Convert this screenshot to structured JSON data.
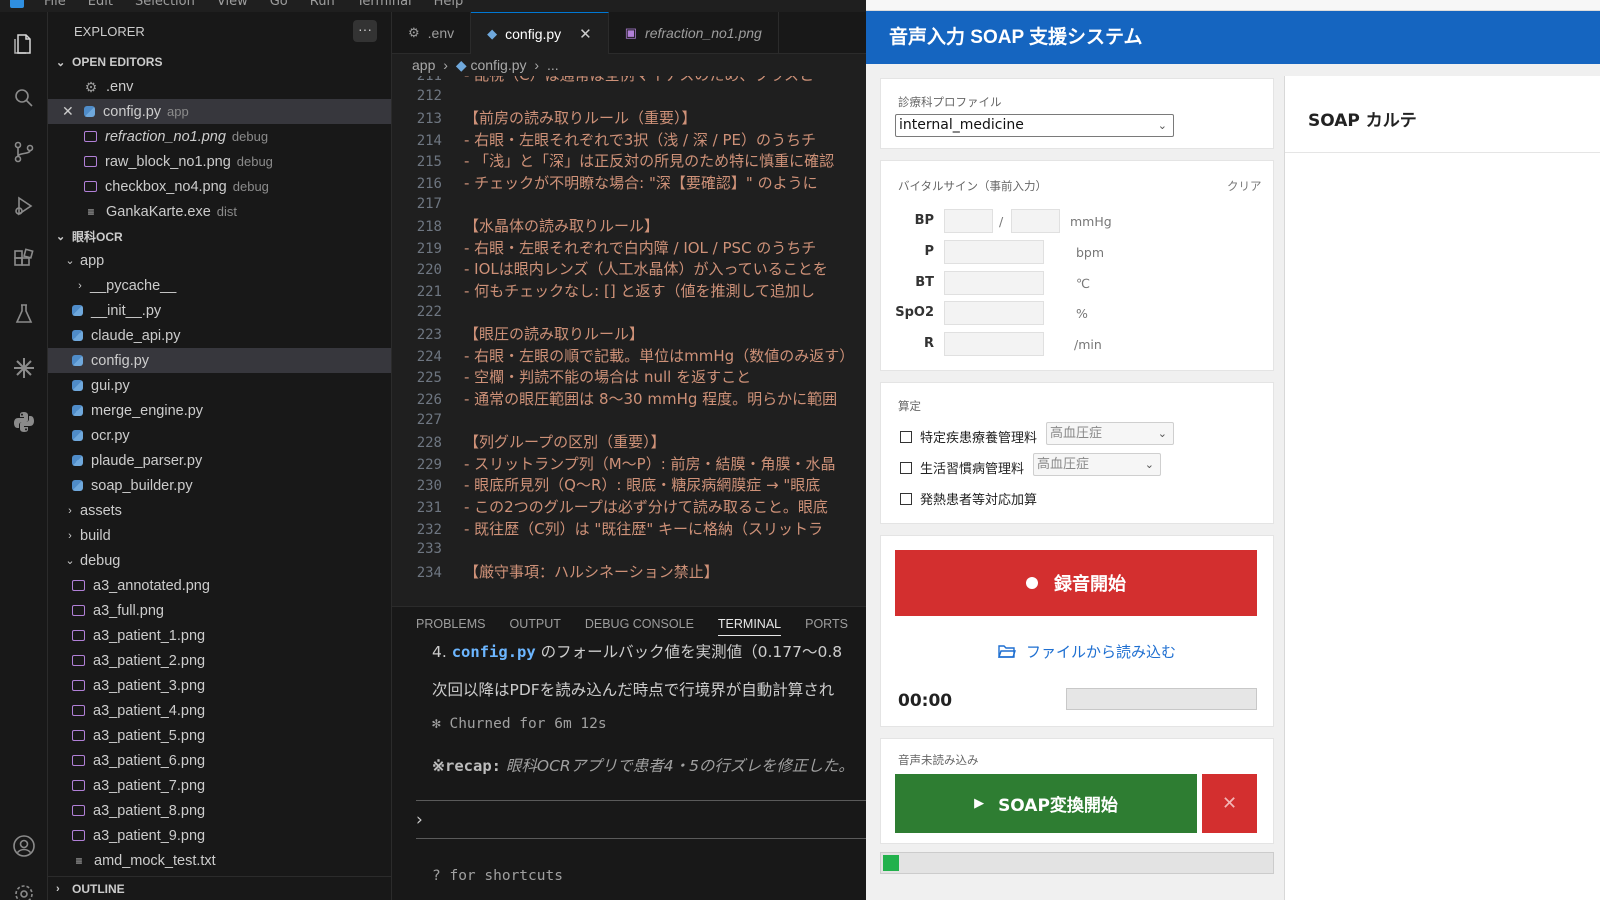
{
  "vscode": {
    "menu": [
      "File",
      "Edit",
      "Selection",
      "View",
      "Go",
      "Run",
      "Terminal",
      "Help"
    ],
    "explorer_title": "EXPLORER",
    "more": "···",
    "open_editors": {
      "label": "OPEN EDITORS",
      "items": [
        {
          "name": ".env",
          "hint": "",
          "type": "gear"
        },
        {
          "name": "config.py",
          "hint": "app",
          "type": "py"
        },
        {
          "name": "refraction_no1.png",
          "hint": "debug",
          "type": "png"
        },
        {
          "name": "raw_block_no1.png",
          "hint": "debug",
          "type": "png"
        },
        {
          "name": "checkbox_no4.png",
          "hint": "debug",
          "type": "png"
        },
        {
          "name": "GankaKarte.exe",
          "hint": "dist",
          "type": "txt"
        }
      ]
    },
    "project": {
      "label": "眼科OCR",
      "app_folder": "app",
      "app_items": [
        "__pycache__",
        "__init__.py",
        "claude_api.py",
        "config.py",
        "gui.py",
        "merge_engine.py",
        "ocr.py",
        "plaude_parser.py",
        "soap_builder.py"
      ],
      "folders": [
        "assets",
        "build",
        "debug"
      ],
      "debug_items": [
        "a3_annotated.png",
        "a3_full.png",
        "a3_patient_1.png",
        "a3_patient_2.png",
        "a3_patient_3.png",
        "a3_patient_4.png",
        "a3_patient_5.png",
        "a3_patient_6.png",
        "a3_patient_7.png",
        "a3_patient_8.png",
        "a3_patient_9.png",
        "amd_mock_test.txt"
      ]
    },
    "outline": "OUTLINE",
    "tabs": [
      ".env",
      "config.py",
      "refraction_no1.png"
    ],
    "breadcrumb": {
      "folder": "app",
      "file": "config.py",
      "tail": "..."
    },
    "code_lines": [
      {
        "n": "211",
        "t": "- 乱視（C）は通常は全例マイナスのため、プラスと"
      },
      {
        "n": "212",
        "t": ""
      },
      {
        "n": "213",
        "t": "【前房の読み取りルール（重要）】"
      },
      {
        "n": "214",
        "t": "- 右眼・左眼それぞれで3択（浅 / 深 / PE）のうちチ"
      },
      {
        "n": "215",
        "t": "- 「浅」と「深」は正反対の所見のため特に慎重に確認"
      },
      {
        "n": "216",
        "t": "- チェックが不明瞭な場合: \"深【要確認】\" のように"
      },
      {
        "n": "217",
        "t": ""
      },
      {
        "n": "218",
        "t": "【水晶体の読み取りルール】"
      },
      {
        "n": "219",
        "t": "- 右眼・左眼それぞれで白内障 / IOL / PSC のうちチ"
      },
      {
        "n": "220",
        "t": "- IOLは眼内レンズ（人工水晶体）が入っていることを"
      },
      {
        "n": "221",
        "t": "- 何もチェックなし: [] と返す（値を推測して追加し"
      },
      {
        "n": "222",
        "t": ""
      },
      {
        "n": "223",
        "t": "【眼圧の読み取りルール】"
      },
      {
        "n": "224",
        "t": "- 右眼・左眼の順で記載。単位はmmHg（数値のみ返す）"
      },
      {
        "n": "225",
        "t": "- 空欄・判読不能の場合は null を返すこと"
      },
      {
        "n": "226",
        "t": "- 通常の眼圧範囲は 8〜30 mmHg 程度。明らかに範囲"
      },
      {
        "n": "227",
        "t": ""
      },
      {
        "n": "228",
        "t": "【列グループの区別（重要）】"
      },
      {
        "n": "229",
        "t": "- スリットランプ列（M〜P）: 前房・結膜・角膜・水晶"
      },
      {
        "n": "230",
        "t": "- 眼底所見列（Q〜R）: 眼底・糖尿病網膜症 → \"眼底"
      },
      {
        "n": "231",
        "t": "- この2つのグループは必ず分けて読み取ること。眼底"
      },
      {
        "n": "232",
        "t": "- 既往歴（C列）は \"既往歴\" キーに格納（スリットラ"
      },
      {
        "n": "233",
        "t": ""
      },
      {
        "n": "234",
        "t": "【厳守事項：ハルシネーション禁止】"
      }
    ],
    "panel_tabs": [
      "PROBLEMS",
      "OUTPUT",
      "DEBUG CONSOLE",
      "TERMINAL",
      "PORTS"
    ],
    "terminal": {
      "line1_prefix": "4. ",
      "line1_file": "config.py",
      "line1_rest": " のフォールバック値を実測値（0.177〜0.8",
      "line2": "次回以降はPDFを読み込んだ時点で行境界が自動計算され",
      "churned": "✻ Churned for 6m 12s",
      "recap_label": "※recap:",
      "recap_text": " 眼科OCRアプリで患者4・5の行ズレを修正した。",
      "prompt": "›",
      "shortcuts": "? for shortcuts"
    }
  },
  "app": {
    "title": "音声入力 SOAP 支援システム",
    "profile_label": "診療科プロファイル",
    "profile_value": "internal_medicine",
    "vitals_label": "バイタルサイン（事前入力）",
    "vitals_clear": "クリア",
    "vitals": [
      {
        "label": "BP",
        "unit": "mmHg"
      },
      {
        "label": "P",
        "unit": "bpm"
      },
      {
        "label": "BT",
        "unit": "℃"
      },
      {
        "label": "SpO2",
        "unit": "%"
      },
      {
        "label": "R",
        "unit": "/min"
      }
    ],
    "bp_sep": "/",
    "santei_label": "算定",
    "checks": [
      {
        "label": "特定疾患療養管理料",
        "select": "高血圧症"
      },
      {
        "label": "生活習慣病管理料",
        "select": "高血圧症"
      },
      {
        "label": "発熱患者等対応加算",
        "select": ""
      }
    ],
    "record_button": "録音開始",
    "file_link": "ファイルから読み込む",
    "timer": "00:00",
    "audio_status": "音声未読み込み",
    "soap_button": "SOAP変換開始",
    "cancel_symbol": "✕",
    "soap_panel_title": "SOAP カルテ",
    "progress": 0.04
  }
}
